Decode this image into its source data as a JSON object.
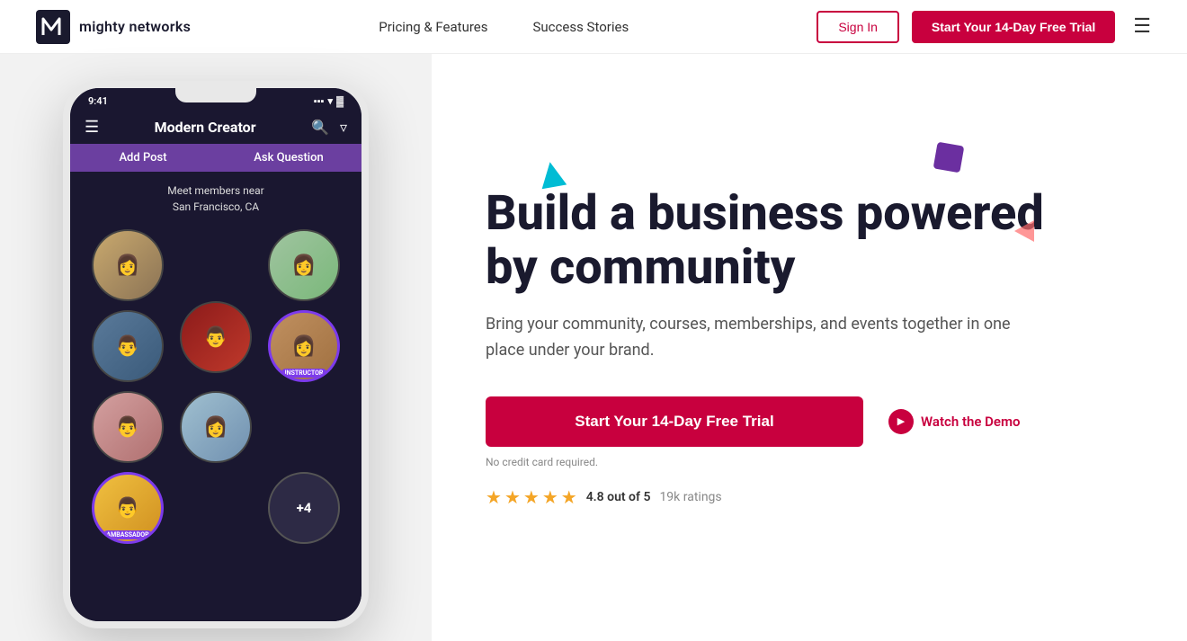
{
  "header": {
    "logo_text": "mighty networks",
    "nav": {
      "pricing": "Pricing & Features",
      "stories": "Success Stories"
    },
    "signin_label": "Sign In",
    "trial_label": "Start Your 14-Day Free Trial"
  },
  "phone": {
    "time": "9:41",
    "app_title": "Modern Creator",
    "tab1": "Add Post",
    "tab2": "Ask Question",
    "location_line1": "Meet members near",
    "location_line2": "San Francisco, CA",
    "plus_count": "+4",
    "ambassador_badge": "AMBASSADOR",
    "instructor_badge": "INSTRUCTOR"
  },
  "hero": {
    "title": "Build a business powered by community",
    "subtitle": "Bring your community, courses, memberships, and events together in one place under your brand.",
    "cta_button": "Start Your 14-Day Free Trial",
    "watch_demo": "Watch the Demo",
    "no_credit": "No credit card required.",
    "rating_value": "4.8 out of 5",
    "rating_count": "19k ratings"
  },
  "colors": {
    "accent": "#c8003e",
    "teal": "#00bcd4",
    "purple": "#6b2fa0",
    "coral": "#ff6b6b"
  }
}
